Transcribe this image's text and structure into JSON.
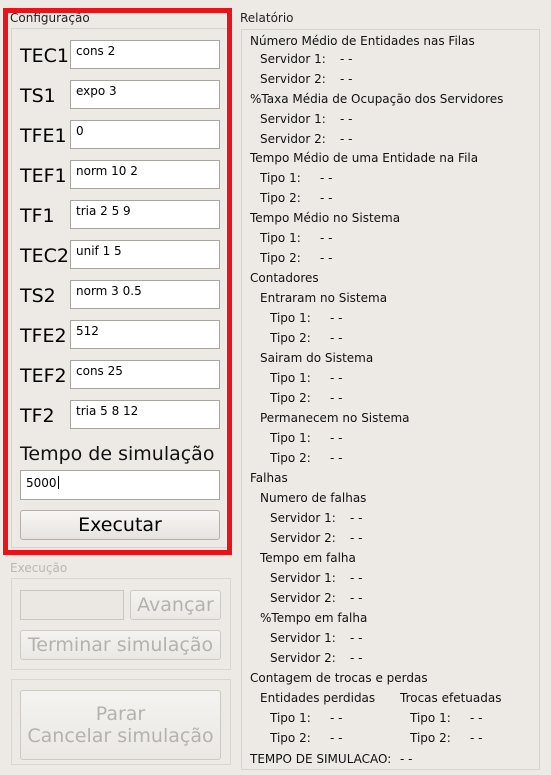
{
  "config": {
    "title": "Configuração",
    "params": [
      {
        "label": "TEC1",
        "value": "cons 2"
      },
      {
        "label": "TS1",
        "value": "expo 3"
      },
      {
        "label": "TFE1",
        "value": "0"
      },
      {
        "label": "TEF1",
        "value": "norm 10 2"
      },
      {
        "label": "TF1",
        "value": "tria 2 5 9"
      },
      {
        "label": "TEC2",
        "value": "unif 1 5"
      },
      {
        "label": "TS2",
        "value": "norm 3 0.5"
      },
      {
        "label": "TFE2",
        "value": "512"
      },
      {
        "label": "TEF2",
        "value": "cons 25"
      },
      {
        "label": "TF2",
        "value": "tria 5 8 12"
      }
    ],
    "sim_time_label": "Tempo de simulação",
    "sim_time_value": "5000",
    "run_label": "Executar",
    "highlight_color": "#e8141a"
  },
  "execution": {
    "title": "Execução",
    "progress_value": "",
    "advance_label": "Avançar",
    "finish_label": "Terminar simulação",
    "stop_label_line1": "Parar",
    "stop_label_line2": "Cancelar simulação"
  },
  "report": {
    "title": "Relatório",
    "queue_avg_title": "Número Médio de Entidades nas Filas",
    "queue_avg": [
      {
        "label": "Servidor 1:",
        "value": "- -"
      },
      {
        "label": "Servidor 2:",
        "value": "- -"
      }
    ],
    "occupancy_title": "%Taxa Média de Ocupação dos Servidores",
    "occupancy": [
      {
        "label": "Servidor 1:",
        "value": "- -"
      },
      {
        "label": "Servidor 2:",
        "value": "- -"
      }
    ],
    "queue_time_title": "Tempo Médio de uma Entidade na Fila",
    "queue_time": [
      {
        "label": "Tipo 1:",
        "value": "- -"
      },
      {
        "label": "Tipo 2:",
        "value": "- -"
      }
    ],
    "system_time_title": "Tempo Médio no Sistema",
    "system_time": [
      {
        "label": "Tipo 1:",
        "value": "- -"
      },
      {
        "label": "Tipo 2:",
        "value": "- -"
      }
    ],
    "counters_title": "Contadores",
    "entered_title": "Entraram no Sistema",
    "entered": [
      {
        "label": "Tipo 1:",
        "value": "- -"
      },
      {
        "label": "Tipo 2:",
        "value": "- -"
      }
    ],
    "left_title": "Sairam do Sistema",
    "left": [
      {
        "label": "Tipo 1:",
        "value": "- -"
      },
      {
        "label": "Tipo 2:",
        "value": "- -"
      }
    ],
    "remain_title": "Permanecem no Sistema",
    "remain": [
      {
        "label": "Tipo 1:",
        "value": "- -"
      },
      {
        "label": "Tipo 2:",
        "value": "- -"
      }
    ],
    "failures_title": "Falhas",
    "fail_count_title": "Numero de falhas",
    "fail_count": [
      {
        "label": "Servidor 1:",
        "value": "- -"
      },
      {
        "label": "Servidor 2:",
        "value": "- -"
      }
    ],
    "fail_time_title": "Tempo em falha",
    "fail_time": [
      {
        "label": "Servidor 1:",
        "value": "- -"
      },
      {
        "label": "Servidor 2:",
        "value": "- -"
      }
    ],
    "fail_pct_title": "%Tempo em falha",
    "fail_pct": [
      {
        "label": "Servidor 1:",
        "value": "- -"
      },
      {
        "label": "Servidor 2:",
        "value": "- -"
      }
    ],
    "exchanges_title": "Contagem de trocas e perdas",
    "lost_title": "Entidades perdidas",
    "lost": [
      {
        "label": "Tipo 1:",
        "value": "- -"
      },
      {
        "label": "Tipo 2:",
        "value": "- -"
      }
    ],
    "swaps_title": "Trocas efetuadas",
    "swaps": [
      {
        "label": "Tipo 1:",
        "value": "- -"
      },
      {
        "label": "Tipo 2:",
        "value": "- -"
      }
    ],
    "sim_time_label": "TEMPO DE SIMULACAO:",
    "sim_time_value": "- -"
  }
}
